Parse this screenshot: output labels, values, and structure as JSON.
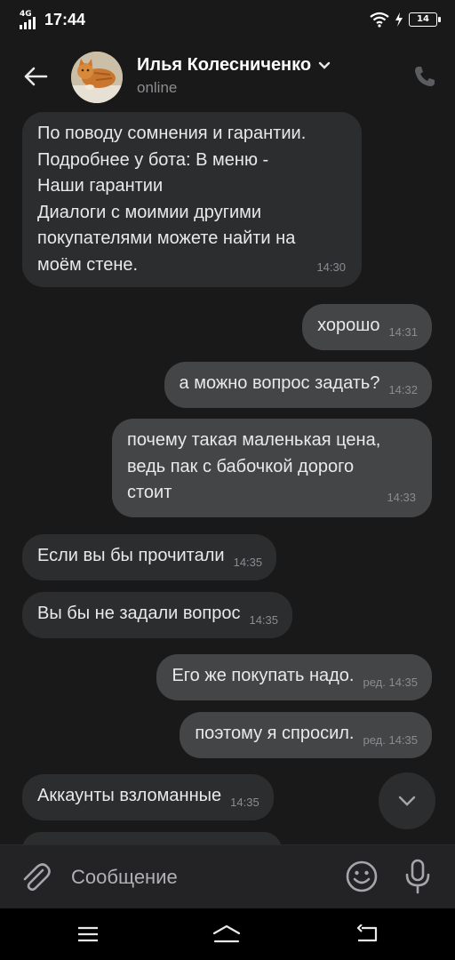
{
  "status_bar": {
    "network": "4G",
    "time": "17:44",
    "battery": "14"
  },
  "header": {
    "contact_name": "Илья Колесниченко",
    "status": "online"
  },
  "messages": [
    {
      "dir": "in",
      "text": "По поводу сомнения и гарантии.\nПодробнее у бота: В меню -\nНаши гарантии\nДиалоги с моимии другими\nпокупателями можете найти на\nмоём стене.",
      "time": "14:30"
    },
    {
      "dir": "out",
      "text": "хорошо",
      "time": "14:31"
    },
    {
      "dir": "out",
      "text": "а можно вопрос задать?",
      "time": "14:32"
    },
    {
      "dir": "out",
      "text": "почему такая маленькая цена,\nведь пак с бабочкой дорого\nстоит",
      "time": "14:33"
    },
    {
      "dir": "in",
      "text": "Если вы бы прочитали",
      "time": "14:35"
    },
    {
      "dir": "in",
      "text": "Вы бы не задали вопрос",
      "time": "14:35"
    },
    {
      "dir": "out",
      "text": "Его же покупать надо.",
      "time": "ред. 14:35"
    },
    {
      "dir": "out",
      "text": "поэтому я спросил.",
      "time": "ред. 14:35"
    },
    {
      "dir": "in",
      "text": "Аккаунты взломанные",
      "time": "14:35"
    }
  ],
  "composer": {
    "placeholder": "Сообщение"
  },
  "colors": {
    "background": "#19191a",
    "incoming_bubble": "#2c2d2e",
    "outgoing_bubble": "#444547",
    "timestamp": "#8b8c8f"
  },
  "icons": [
    "back-arrow-icon",
    "chevron-down-icon",
    "phone-icon",
    "paperclip-icon",
    "emoji-icon",
    "microphone-icon",
    "menu-icon",
    "home-icon",
    "back-icon",
    "wifi-icon",
    "charging-icon"
  ]
}
